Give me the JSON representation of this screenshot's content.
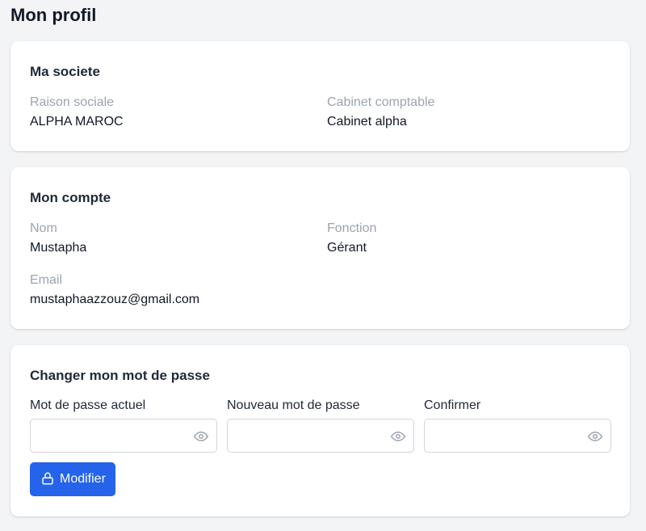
{
  "page": {
    "title": "Mon profil"
  },
  "company": {
    "title": "Ma societe",
    "fields": [
      {
        "label": "Raison sociale",
        "value": "ALPHA MAROC"
      },
      {
        "label": "Cabinet comptable",
        "value": "Cabinet alpha"
      }
    ]
  },
  "account": {
    "title": "Mon compte",
    "fields": [
      {
        "label": "Nom",
        "value": "Mustapha"
      },
      {
        "label": "Fonction",
        "value": "Gérant"
      },
      {
        "label": "Email",
        "value": "mustaphaazzouz@gmail.com"
      }
    ]
  },
  "password": {
    "title": "Changer mon mot de passe",
    "fields": [
      {
        "label": "Mot de passe actuel",
        "value": "",
        "icon": "eye-icon"
      },
      {
        "label": "Nouveau mot de passe",
        "value": "",
        "icon": "eye-icon"
      },
      {
        "label": "Confirmer",
        "value": "",
        "icon": "eye-icon"
      }
    ],
    "submit": {
      "label": "Modifier",
      "icon": "lock-icon"
    }
  },
  "colors": {
    "background": "#f3f4f6",
    "card": "#ffffff",
    "accent": "#2563eb",
    "muted_label": "#9ca3af",
    "text": "#111827"
  }
}
